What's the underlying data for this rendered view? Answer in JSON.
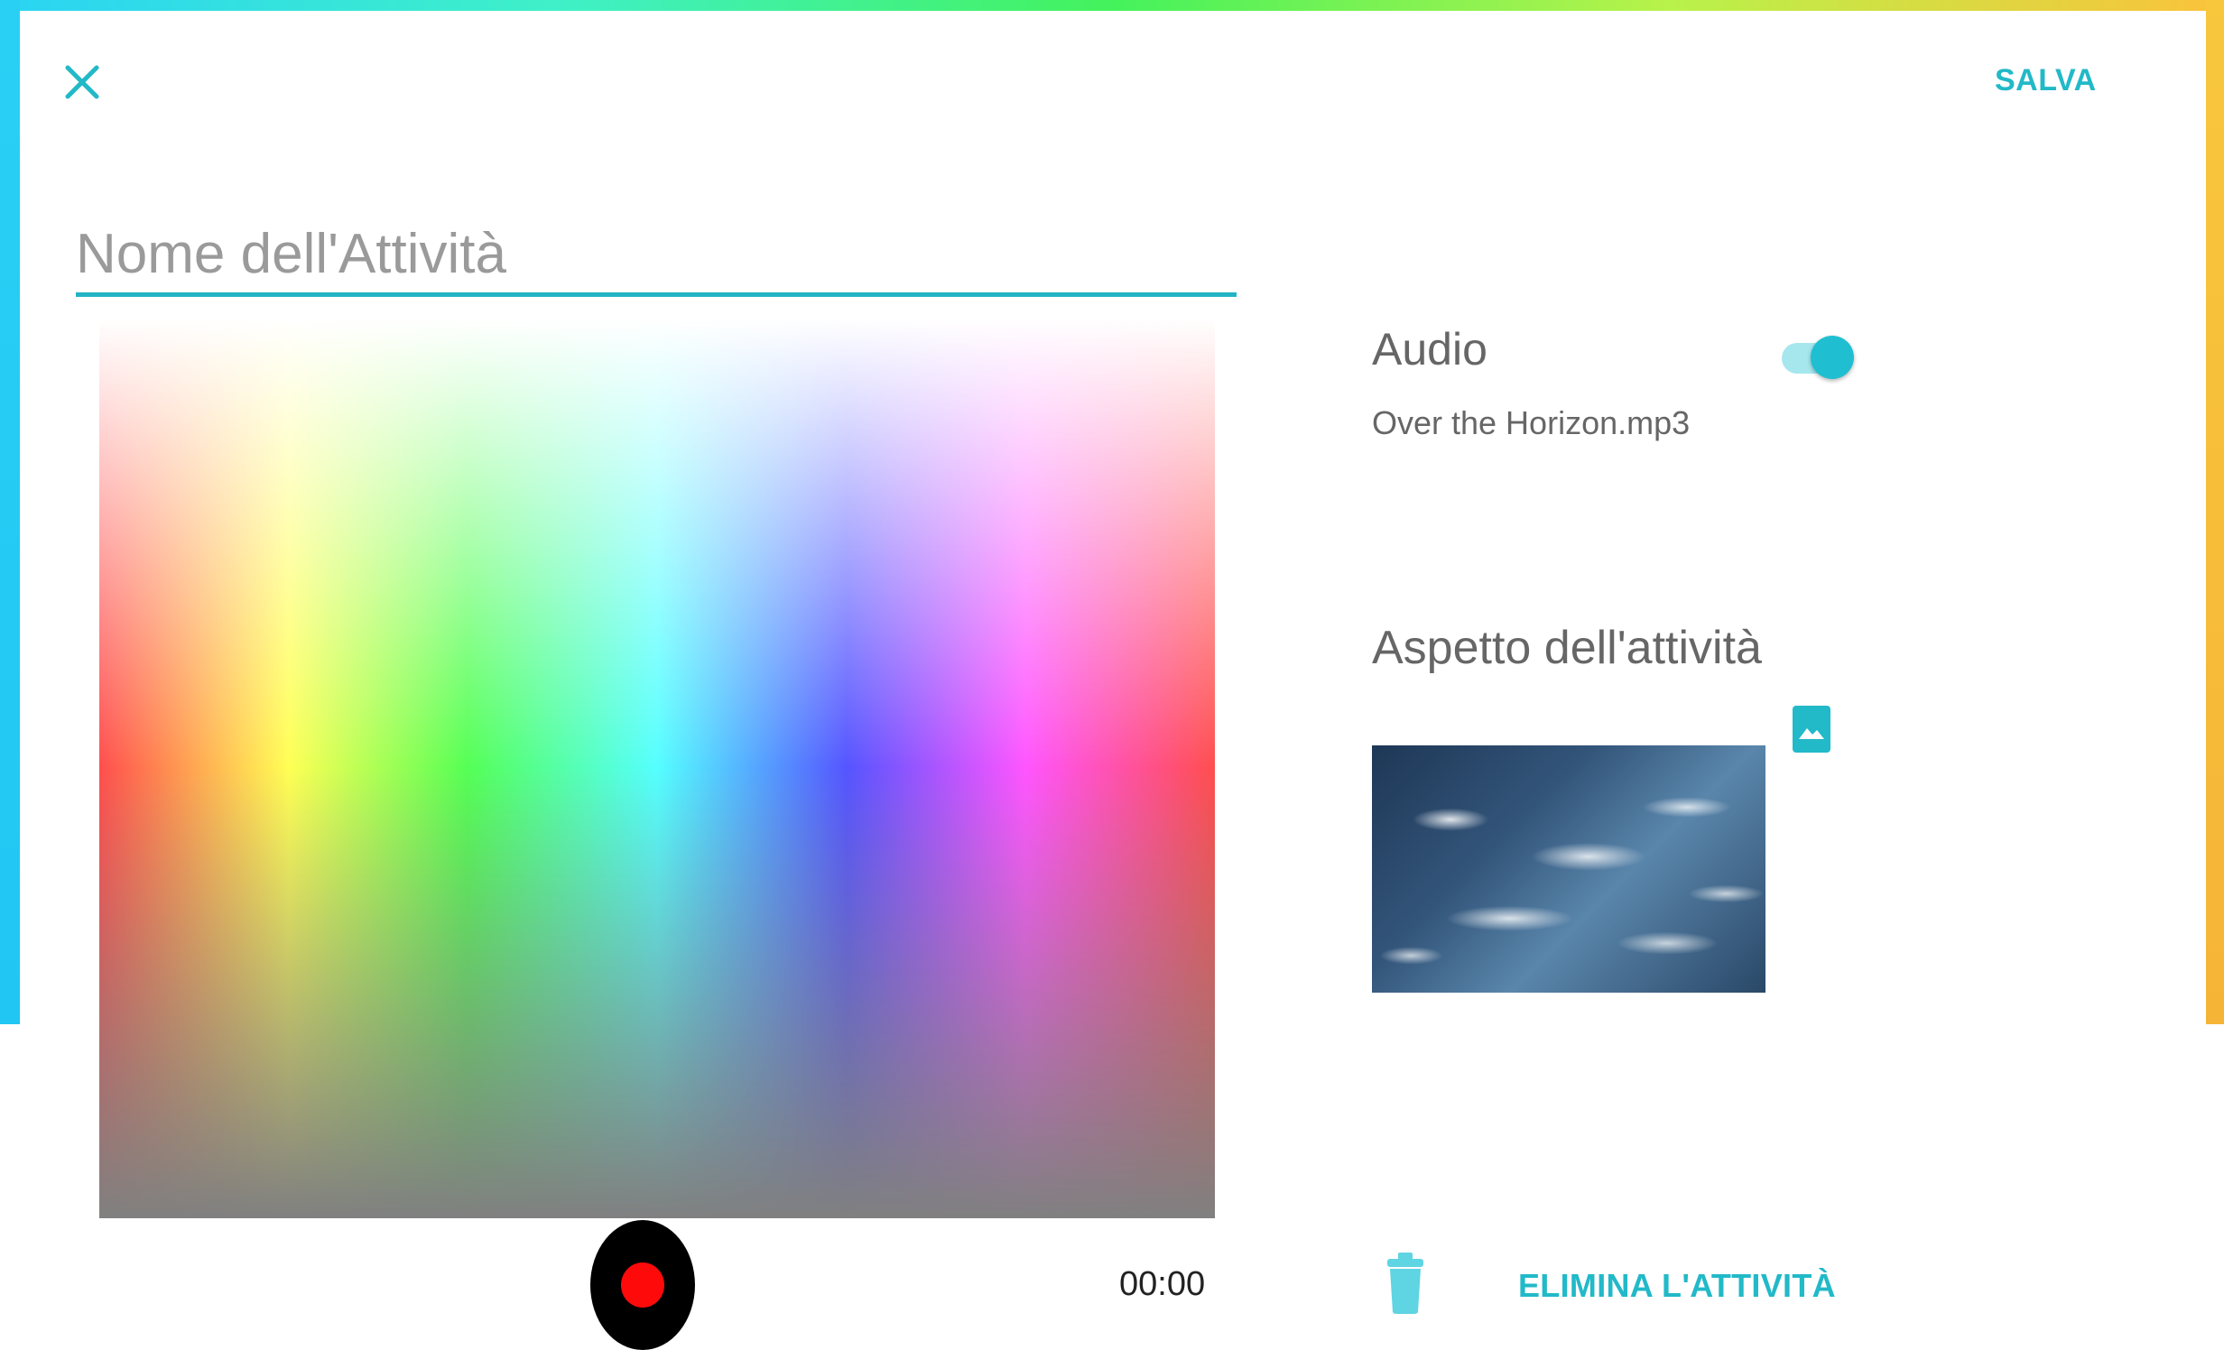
{
  "header": {
    "close_icon": "close-icon",
    "save_label": "SALVA"
  },
  "name_field": {
    "placeholder": "Nome dell'Attività",
    "value": ""
  },
  "recorder": {
    "timer": "00:00",
    "record_icon": "record-icon"
  },
  "audio": {
    "title": "Audio",
    "file_name": "Over the Horizon.mp3",
    "enabled": true
  },
  "appearance": {
    "title": "Aspetto dell'attività",
    "image_icon": "image-icon"
  },
  "delete": {
    "icon": "trash-icon",
    "label": "ELIMINA L'ATTIVITÀ"
  },
  "colors": {
    "accent": "#22b9c8",
    "record_red": "#ff0a0a",
    "text_gray": "#666666"
  }
}
